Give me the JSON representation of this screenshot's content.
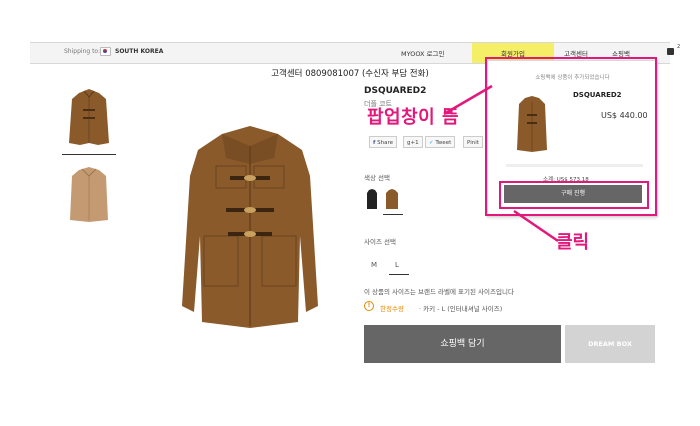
{
  "topbar": {
    "shipping_label": "Shipping to:",
    "country": "SOUTH KOREA",
    "nav": [
      "MYOOX 로그인",
      "회원가입",
      "고객센터",
      "쇼핑백"
    ],
    "bag_count": "2"
  },
  "service_line": "고객센터 0809081007 (수신자 부담 전화)",
  "product": {
    "brand": "DSQUARED2",
    "subtitle": "더플 코트",
    "social": [
      "Share",
      "+1",
      "Tweet",
      "Pinit"
    ],
    "color_label": "색상 선택",
    "size_label": "사이즈 선택",
    "sizes": [
      "M",
      "L"
    ],
    "size_note": "이 상품의 사이즈는 브랜드 라벨에 표기된 사이즈입니다",
    "limit_strong": "한정수량",
    "limit_text": "· 카키 - L (인터내셔널 사이즈)",
    "limit_icon": "!",
    "add_to_bag": "쇼핑백 담기",
    "dream_box": "DREAM BOX"
  },
  "popup": {
    "message": "쇼핑백에 상품이 추가되었습니다",
    "brand": "DSQUARED2",
    "price": "US$ 440.00",
    "subtotal": "소계: US$ 573.18",
    "checkout": "구매 진행"
  },
  "annotations": {
    "popup_opens": "팝업창이 뜸",
    "click": "클릭",
    "color": "#e2187c"
  },
  "colors": {
    "highlight_nav": "#f4ef66",
    "primary_button": "#666666",
    "coat": "#8a5a2b"
  },
  "icons": [
    "flag-korea-icon",
    "shopping-bag-icon",
    "warning-icon",
    "facebook-icon",
    "google-plus-icon",
    "twitter-icon",
    "pinterest-icon"
  ]
}
